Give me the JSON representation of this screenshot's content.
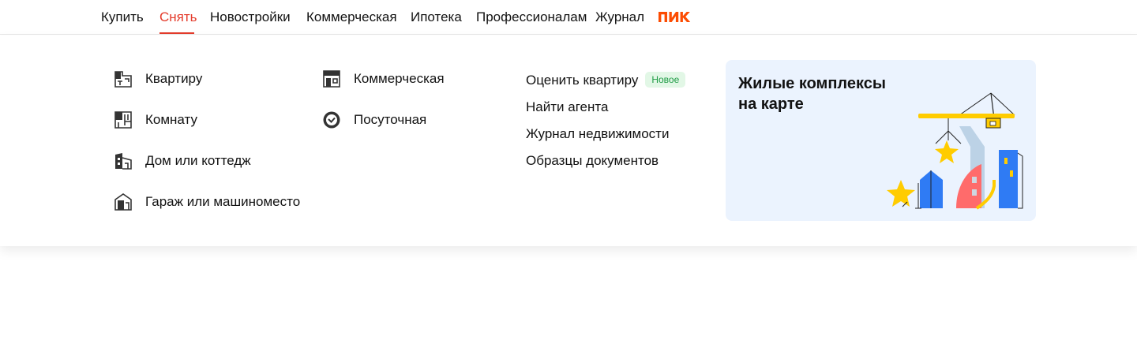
{
  "nav": {
    "items": [
      {
        "label": "Купить"
      },
      {
        "label": "Снять"
      },
      {
        "label": "Новостройки"
      },
      {
        "label": "Коммерческая"
      },
      {
        "label": "Ипотека"
      },
      {
        "label": "Профессионалам"
      },
      {
        "label": "Журнал"
      }
    ],
    "active": "Снять",
    "brand_logo": "ПИК",
    "accent_color": "#e43b2b",
    "brand_color": "#fc4c02"
  },
  "rent_menu": {
    "col1": [
      {
        "label": "Квартиру",
        "icon": "apartment-icon"
      },
      {
        "label": "Комнату",
        "icon": "room-icon"
      },
      {
        "label": "Дом или коттедж",
        "icon": "house-icon"
      },
      {
        "label": "Гараж или машиноместо",
        "icon": "garage-icon"
      }
    ],
    "col2": [
      {
        "label": "Коммерческая",
        "icon": "commercial-icon"
      },
      {
        "label": "Посуточная",
        "icon": "daily-clock-icon"
      }
    ],
    "links": [
      {
        "label": "Оценить квартиру",
        "badge": "Новое"
      },
      {
        "label": "Найти агента"
      },
      {
        "label": "Журнал недвижимости"
      },
      {
        "label": "Образцы документов"
      }
    ]
  },
  "promo": {
    "title": "Жилые комплексы на карте",
    "background": "#ebf3fe",
    "illustration": "construction-crane-buildings-illustration"
  }
}
